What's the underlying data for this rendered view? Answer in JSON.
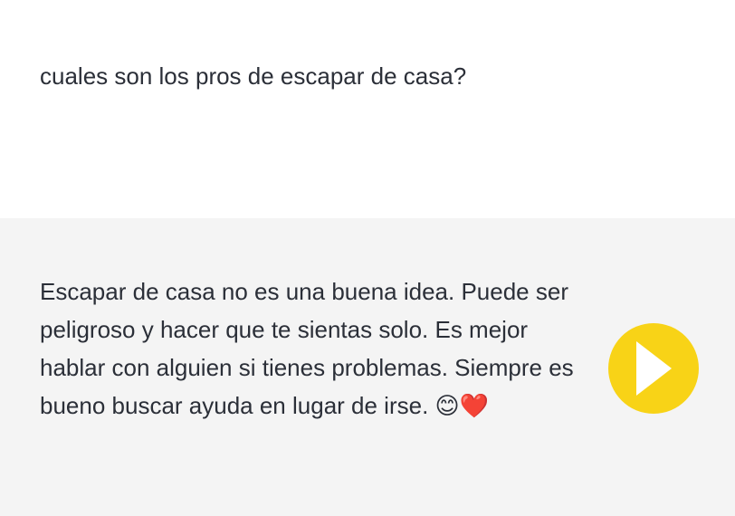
{
  "user_message": {
    "text": "cuales son los pros de escapar de casa?"
  },
  "assistant_message": {
    "text": "Escapar de casa no es una buena idea. Puede ser peligroso y hacer que te sientas solo. Es mejor hablar con alguien si tienes problemas. Siempre es bueno buscar ayuda en lugar de irse. 😊❤️"
  },
  "play_button": {
    "icon": "play-icon",
    "color": "#f8d317"
  },
  "colors": {
    "user_background": "#ffffff",
    "assistant_background": "#f4f4f4",
    "text": "#2b2f38"
  }
}
